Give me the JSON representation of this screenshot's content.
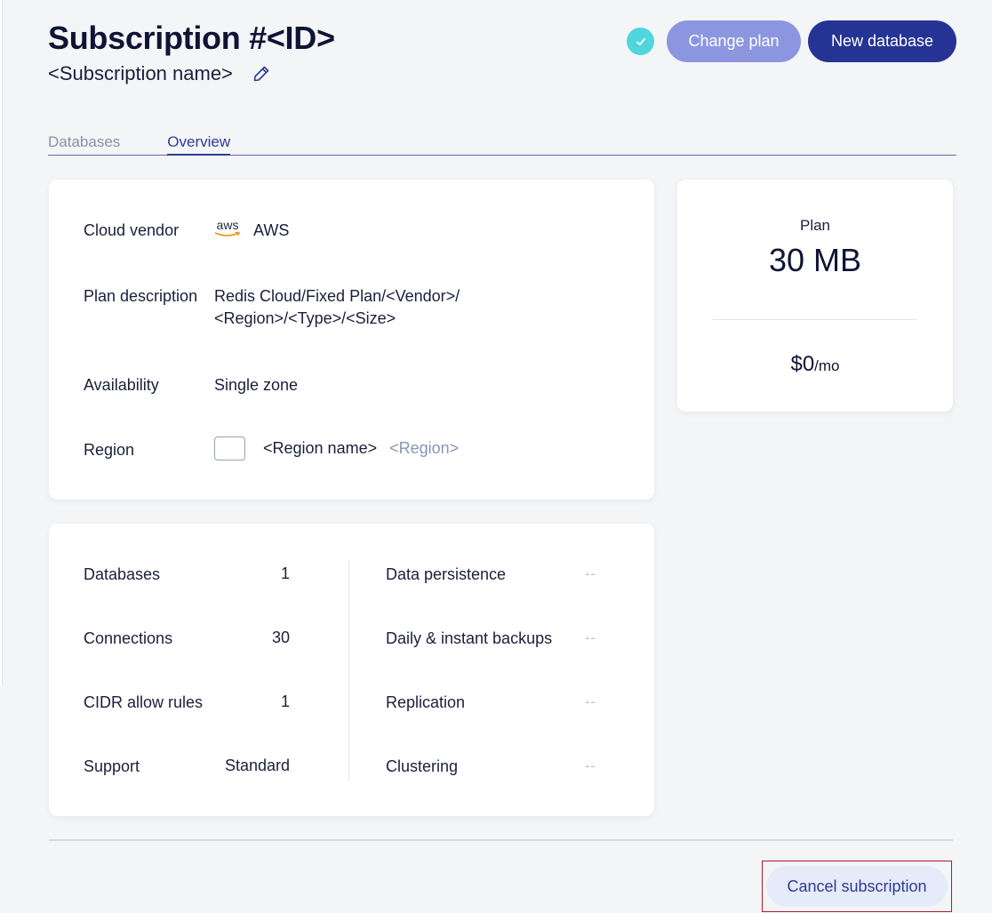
{
  "header": {
    "title": "Subscription #<ID>",
    "subtitle": "<Subscription name>"
  },
  "actions": {
    "change_plan_label": "Change plan",
    "new_database_label": "New database"
  },
  "tabs": [
    {
      "label": "Databases"
    },
    {
      "label": "Overview",
      "active": true
    }
  ],
  "info": {
    "cloud_vendor_label": "Cloud vendor",
    "cloud_vendor_logo": "aws",
    "cloud_vendor_value": "AWS",
    "plan_description_label": "Plan description",
    "plan_description_value_line1": "Redis Cloud/Fixed Plan/<Vendor>/",
    "plan_description_value_line2": "<Region>/<Type>/<Size>",
    "availability_label": "Availability",
    "availability_value": "Single zone",
    "region_label": "Region",
    "region_name": "<Region name>",
    "region_code": "<Region>"
  },
  "plan": {
    "label": "Plan",
    "size": "30 MB",
    "price": "$0",
    "price_period": "/mo"
  },
  "stats_left": [
    {
      "label": "Databases",
      "value": "1"
    },
    {
      "label": "Connections",
      "value": "30"
    },
    {
      "label": "CIDR allow rules",
      "value": "1"
    },
    {
      "label": "Support",
      "value": "Standard"
    }
  ],
  "stats_right": [
    {
      "label": "Data persistence",
      "value": "--"
    },
    {
      "label": "Daily & instant backups",
      "value": "--"
    },
    {
      "label": "Replication",
      "value": "--"
    },
    {
      "label": "Clustering",
      "value": "--"
    }
  ],
  "footer": {
    "cancel_label": "Cancel subscription"
  },
  "colors": {
    "accent": "#253494",
    "accent_light": "#8c96e0",
    "status": "#4fd6dc",
    "cancel_highlight": "#b11a2a"
  }
}
